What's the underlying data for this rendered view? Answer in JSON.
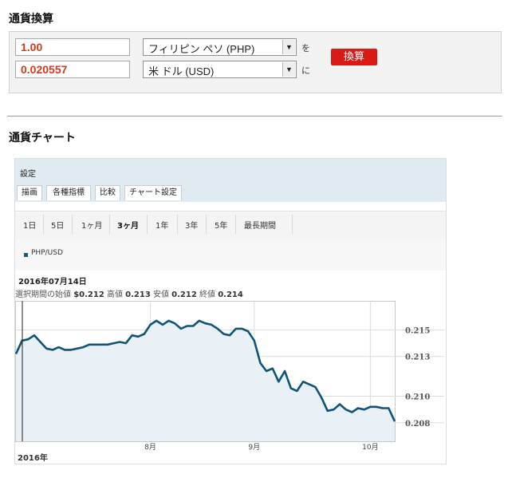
{
  "converter": {
    "title": "通貨換算",
    "from_amount": "1.00",
    "to_amount": "0.020557",
    "from_currency": "フィリピン ペソ (PHP)",
    "to_currency": "米 ドル (USD)",
    "particle_from": "を",
    "particle_to": "に",
    "convert_label": "換算"
  },
  "chart_section": {
    "title": "通貨チャート",
    "settings_label": "設定",
    "tabs": [
      "描画",
      "各種指標",
      "比較",
      "チャート設定"
    ],
    "ranges": [
      "1日",
      "5日",
      "1ヶ月",
      "3ヶ月",
      "1年",
      "3年",
      "5年",
      "最長期間"
    ],
    "selected_range": "3ヶ月",
    "legend_label": "PHP/USD",
    "cursor_date": "2016年07月14日",
    "stats": {
      "open_label": "選択期間の始値",
      "open_value": "$0.212",
      "high_label": "高値",
      "high_value": "0.213",
      "low_label": "安値",
      "low_value": "0.212",
      "close_label": "終値",
      "close_value": "0.214"
    }
  },
  "chart_data": {
    "type": "area",
    "series": [
      {
        "name": "PHP/USD",
        "values": [
          0.2132,
          0.2142,
          0.2143,
          0.2146,
          0.2141,
          0.2136,
          0.2135,
          0.2137,
          0.2135,
          0.2135,
          0.2136,
          0.2137,
          0.2139,
          0.2139,
          0.2139,
          0.2139,
          0.214,
          0.2141,
          0.214,
          0.2146,
          0.2145,
          0.2147,
          0.2154,
          0.2157,
          0.2154,
          0.2157,
          0.2155,
          0.2151,
          0.2153,
          0.2153,
          0.2157,
          0.2155,
          0.2154,
          0.2151,
          0.2147,
          0.2146,
          0.2151,
          0.2151,
          0.2149,
          0.2142,
          0.2125,
          0.2119,
          0.2121,
          0.2111,
          0.2119,
          0.2106,
          0.2104,
          0.2111,
          0.2109,
          0.2107,
          0.2099,
          0.2089,
          0.209,
          0.2094,
          0.209,
          0.2088,
          0.2091,
          0.209,
          0.2092,
          0.2092,
          0.2091,
          0.2091,
          0.2081
        ]
      }
    ],
    "x_ticks": [
      "8月",
      "9月",
      "10月"
    ],
    "x_start_label": "2016年",
    "y_ticks": [
      0.208,
      0.21,
      0.213,
      0.215
    ],
    "y_tick_labels": [
      "0.208",
      "0.210",
      "0.213",
      "0.215"
    ],
    "ylim": [
      0.2066,
      0.2172
    ],
    "grid": true,
    "colors": {
      "line": "#0f5478",
      "fill": "#e9f0f6"
    }
  }
}
